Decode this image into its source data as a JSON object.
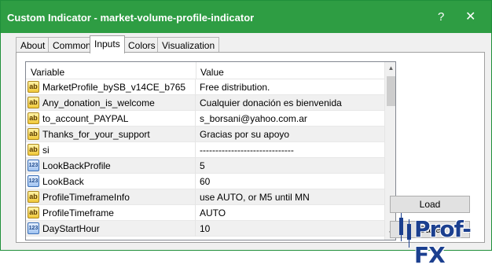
{
  "window": {
    "title": "Custom Indicator - market-volume-profile-indicator",
    "help_glyph": "?",
    "close_glyph": "✕"
  },
  "tabs": [
    {
      "label": "About",
      "active": false
    },
    {
      "label": "Common",
      "active": false
    },
    {
      "label": "Inputs",
      "active": true
    },
    {
      "label": "Colors",
      "active": false
    },
    {
      "label": "Visualization",
      "active": false
    }
  ],
  "grid": {
    "headers": {
      "variable": "Variable",
      "value": "Value"
    },
    "rows": [
      {
        "icon": "string-icon",
        "badge": "ab",
        "variable": "MarketProfile_bySB_v14CE_b765",
        "value": "Free distribution."
      },
      {
        "icon": "string-icon",
        "badge": "ab",
        "variable": "Any_donation_is_welcome",
        "value": "Cualquier donación es bienvenida"
      },
      {
        "icon": "string-icon",
        "badge": "ab",
        "variable": "to_account_PAYPAL",
        "value": "s_borsani@yahoo.com.ar"
      },
      {
        "icon": "string-icon",
        "badge": "ab",
        "variable": "Thanks_for_your_support",
        "value": "Gracias por su apoyo"
      },
      {
        "icon": "string-icon",
        "badge": "ab",
        "variable": "si",
        "value": "------------------------------"
      },
      {
        "icon": "integer-icon",
        "badge": "123",
        "variable": "LookBackProfile",
        "value": "5"
      },
      {
        "icon": "integer-icon",
        "badge": "123",
        "variable": "LookBack",
        "value": "60"
      },
      {
        "icon": "string-icon",
        "badge": "ab",
        "variable": "ProfileTimeframeInfo",
        "value": "use AUTO, or M5 until MN"
      },
      {
        "icon": "string-icon",
        "badge": "ab",
        "variable": "ProfileTimeframe",
        "value": "AUTO"
      },
      {
        "icon": "integer-icon",
        "badge": "123",
        "variable": "DayStartHour",
        "value": "10"
      }
    ]
  },
  "buttons": {
    "load": "Load",
    "save": "Save"
  },
  "watermark": {
    "text": "Prof-FX"
  },
  "colors": {
    "titlebar": "#2e9d43",
    "row_alt": "#f0f0f0",
    "watermark": "#1b3f8f"
  }
}
